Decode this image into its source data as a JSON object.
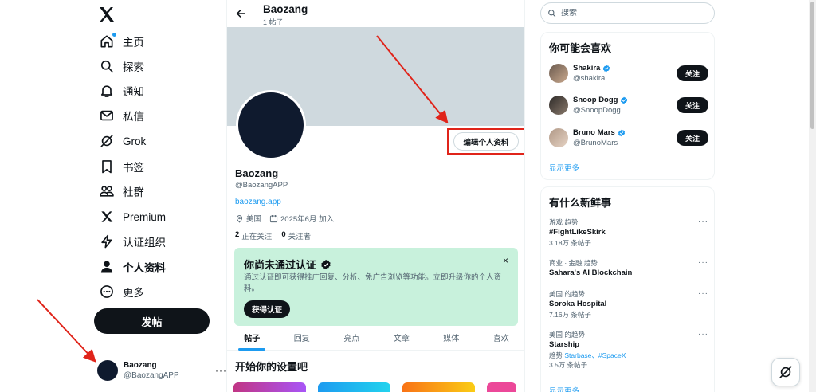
{
  "nav": {
    "items": [
      {
        "label": "主页",
        "icon": "home-icon"
      },
      {
        "label": "探索",
        "icon": "search-icon"
      },
      {
        "label": "通知",
        "icon": "bell-icon"
      },
      {
        "label": "私信",
        "icon": "mail-icon"
      },
      {
        "label": "Grok",
        "icon": "grok-icon"
      },
      {
        "label": "书签",
        "icon": "bookmark-icon"
      },
      {
        "label": "社群",
        "icon": "communities-icon"
      },
      {
        "label": "Premium",
        "icon": "x-premium-icon"
      },
      {
        "label": "认证组织",
        "icon": "lightning-icon"
      },
      {
        "label": "个人资料",
        "icon": "person-icon"
      },
      {
        "label": "更多",
        "icon": "more-circle-icon"
      }
    ],
    "post_button": "发帖",
    "account": {
      "name": "Baozang",
      "handle": "@BaozangAPP",
      "more": "···"
    }
  },
  "header": {
    "name": "Baozang",
    "post_count": "1 帖子"
  },
  "profile": {
    "edit_button": "编辑个人资料",
    "name": "Baozang",
    "handle": "@BaozangAPP",
    "website": "baozang.app",
    "location": "美国",
    "joined": "2025年6月 加入",
    "following_count": "2",
    "following_label": "正在关注",
    "followers_count": "0",
    "followers_label": "关注者"
  },
  "verify_card": {
    "title": "你尚未通过认证",
    "description": "通过认证即可获得推广回复、分析、免广告浏览等功能。立即升级你的个人资料。",
    "button": "获得认证",
    "close": "×"
  },
  "tabs": [
    "帖子",
    "回复",
    "亮点",
    "文章",
    "媒体",
    "喜欢"
  ],
  "setup": {
    "title": "开始你的设置吧"
  },
  "search": {
    "placeholder": "搜索"
  },
  "who_to_follow": {
    "title": "你可能会喜欢",
    "users": [
      {
        "name": "Shakira",
        "handle": "@shakira",
        "button": "关注"
      },
      {
        "name": "Snoop Dogg",
        "handle": "@SnoopDogg",
        "button": "关注"
      },
      {
        "name": "Bruno Mars",
        "handle": "@BrunoMars",
        "button": "关注"
      }
    ],
    "show_more": "显示更多"
  },
  "trends": {
    "title": "有什么新鲜事",
    "items": [
      {
        "meta": "游戏 趋势",
        "name": "#FightLikeSkirk",
        "count": "3.18万 条帖子"
      },
      {
        "meta": "商业 · 金融 趋势",
        "name": "Sahara's AI Blockchain",
        "count": ""
      },
      {
        "meta": "美国 的趋势",
        "name": "Soroka Hospital",
        "count": "7.16万 条帖子"
      },
      {
        "meta": "美国 的趋势",
        "name": "Starship",
        "related_prefix": "趋势",
        "related": "Starbase、#SpaceX",
        "count": "3.5万 条帖子"
      }
    ],
    "show_more": "显示更多",
    "more": "···"
  },
  "colors": {
    "accent": "#1d9bf0",
    "verify_bg": "#c8f1dc",
    "banner": "#cfd9de",
    "annotation": "#e0241a"
  }
}
